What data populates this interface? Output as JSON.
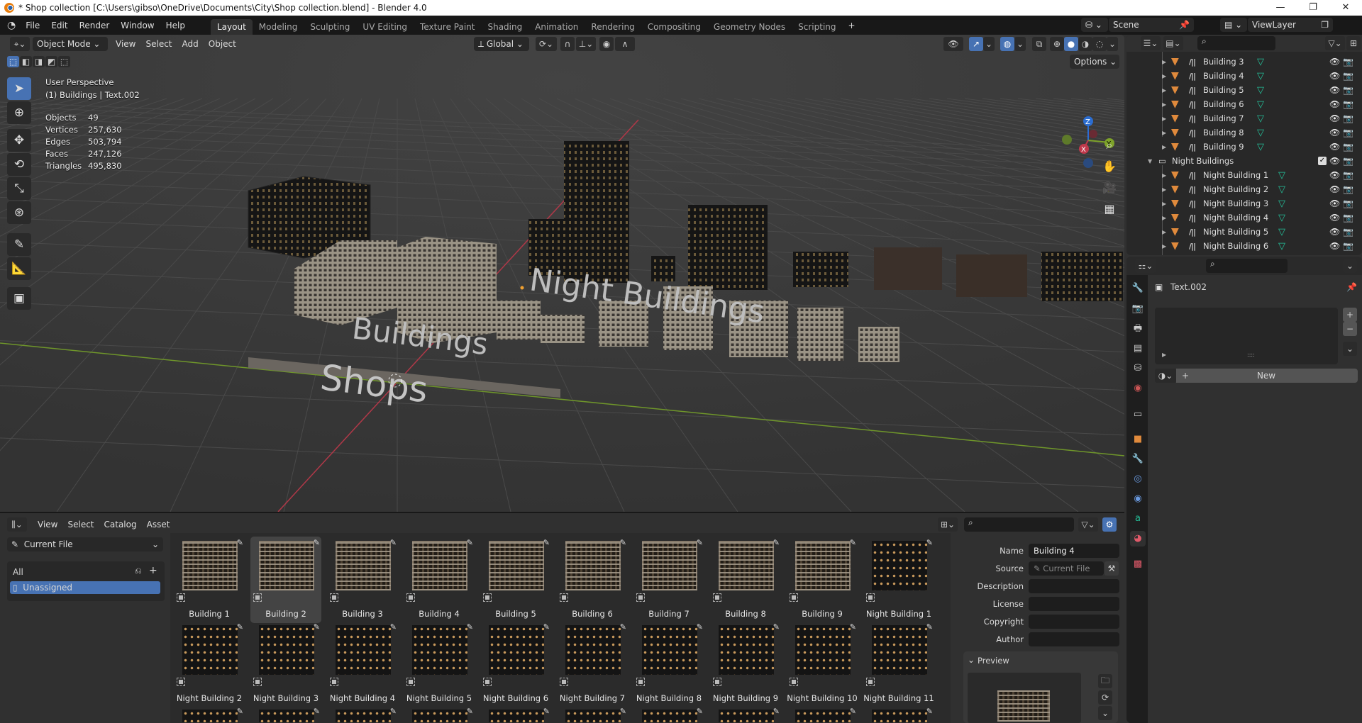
{
  "window": {
    "title": "* Shop collection [C:\\Users\\gibso\\OneDrive\\Documents\\City\\Shop collection.blend] - Blender 4.0",
    "minimize": "—",
    "maximize": "❐",
    "close": "✕"
  },
  "menu": [
    "File",
    "Edit",
    "Render",
    "Window",
    "Help"
  ],
  "workspaces": [
    "Layout",
    "Modeling",
    "Sculpting",
    "UV Editing",
    "Texture Paint",
    "Shading",
    "Animation",
    "Rendering",
    "Compositing",
    "Geometry Nodes",
    "Scripting"
  ],
  "workspace_add": "+",
  "scene": {
    "name": "Scene",
    "view_layer": "ViewLayer"
  },
  "viewport": {
    "mode": "Object Mode",
    "menus": [
      "View",
      "Select",
      "Add",
      "Object"
    ],
    "orientation": "Global",
    "options": "Options",
    "perspective": "User Perspective",
    "context": "(1) Buildings | Text.002",
    "stats": [
      {
        "label": "Objects",
        "value": "49"
      },
      {
        "label": "Vertices",
        "value": "257,630"
      },
      {
        "label": "Edges",
        "value": "503,794"
      },
      {
        "label": "Faces",
        "value": "247,126"
      },
      {
        "label": "Triangles",
        "value": "495,830"
      }
    ],
    "scene_labels": {
      "night": "Night Buildings",
      "buildings": "Buildings",
      "shops": "Shops"
    },
    "gizmo": {
      "x": "X",
      "y": "Y",
      "z": "Z"
    }
  },
  "outliner": {
    "rows": [
      {
        "name": "Building 3",
        "type": "object"
      },
      {
        "name": "Building 4",
        "type": "object"
      },
      {
        "name": "Building 5",
        "type": "object"
      },
      {
        "name": "Building 6",
        "type": "object"
      },
      {
        "name": "Building 7",
        "type": "object"
      },
      {
        "name": "Building 8",
        "type": "object"
      },
      {
        "name": "Building 9",
        "type": "object"
      },
      {
        "name": "Night Buildings",
        "type": "collection"
      },
      {
        "name": "Night Building 1",
        "type": "object"
      },
      {
        "name": "Night Building 2",
        "type": "object"
      },
      {
        "name": "Night Building 3",
        "type": "object"
      },
      {
        "name": "Night Building 4",
        "type": "object"
      },
      {
        "name": "Night Building 5",
        "type": "object"
      },
      {
        "name": "Night Building 6",
        "type": "object"
      }
    ]
  },
  "properties": {
    "object_name": "Text.002",
    "new_button": "New"
  },
  "asset_browser": {
    "menus": [
      "View",
      "Select",
      "Catalog",
      "Asset"
    ],
    "library": "Current File",
    "catalogs": {
      "all": "All",
      "unassigned": "Unassigned"
    },
    "assets_row1": [
      "Building 1",
      "Building 2",
      "Building 3",
      "Building 4",
      "Building 5",
      "Building 6",
      "Building 7",
      "Building 8",
      "Building 9",
      "Night Building 1"
    ],
    "assets_row2": [
      "Night Building 2",
      "Night Building 3",
      "Night Building 4",
      "Night Building 5",
      "Night Building 6",
      "Night Building 7",
      "Night Building 8",
      "Night Building 9",
      "Night Building 10",
      "Night Building 11"
    ],
    "selected": "Building 2",
    "metadata": {
      "name_label": "Name",
      "name": "Building 4",
      "source_label": "Source",
      "source": "Current File",
      "description_label": "Description",
      "license_label": "License",
      "copyright_label": "Copyright",
      "author_label": "Author",
      "preview_label": "Preview"
    }
  },
  "colors": {
    "accent": "#4772b3",
    "object": "#e08a3c",
    "mesh": "#25c19a",
    "x_axis": "#c0394b",
    "y_axis": "#7ea32a"
  }
}
